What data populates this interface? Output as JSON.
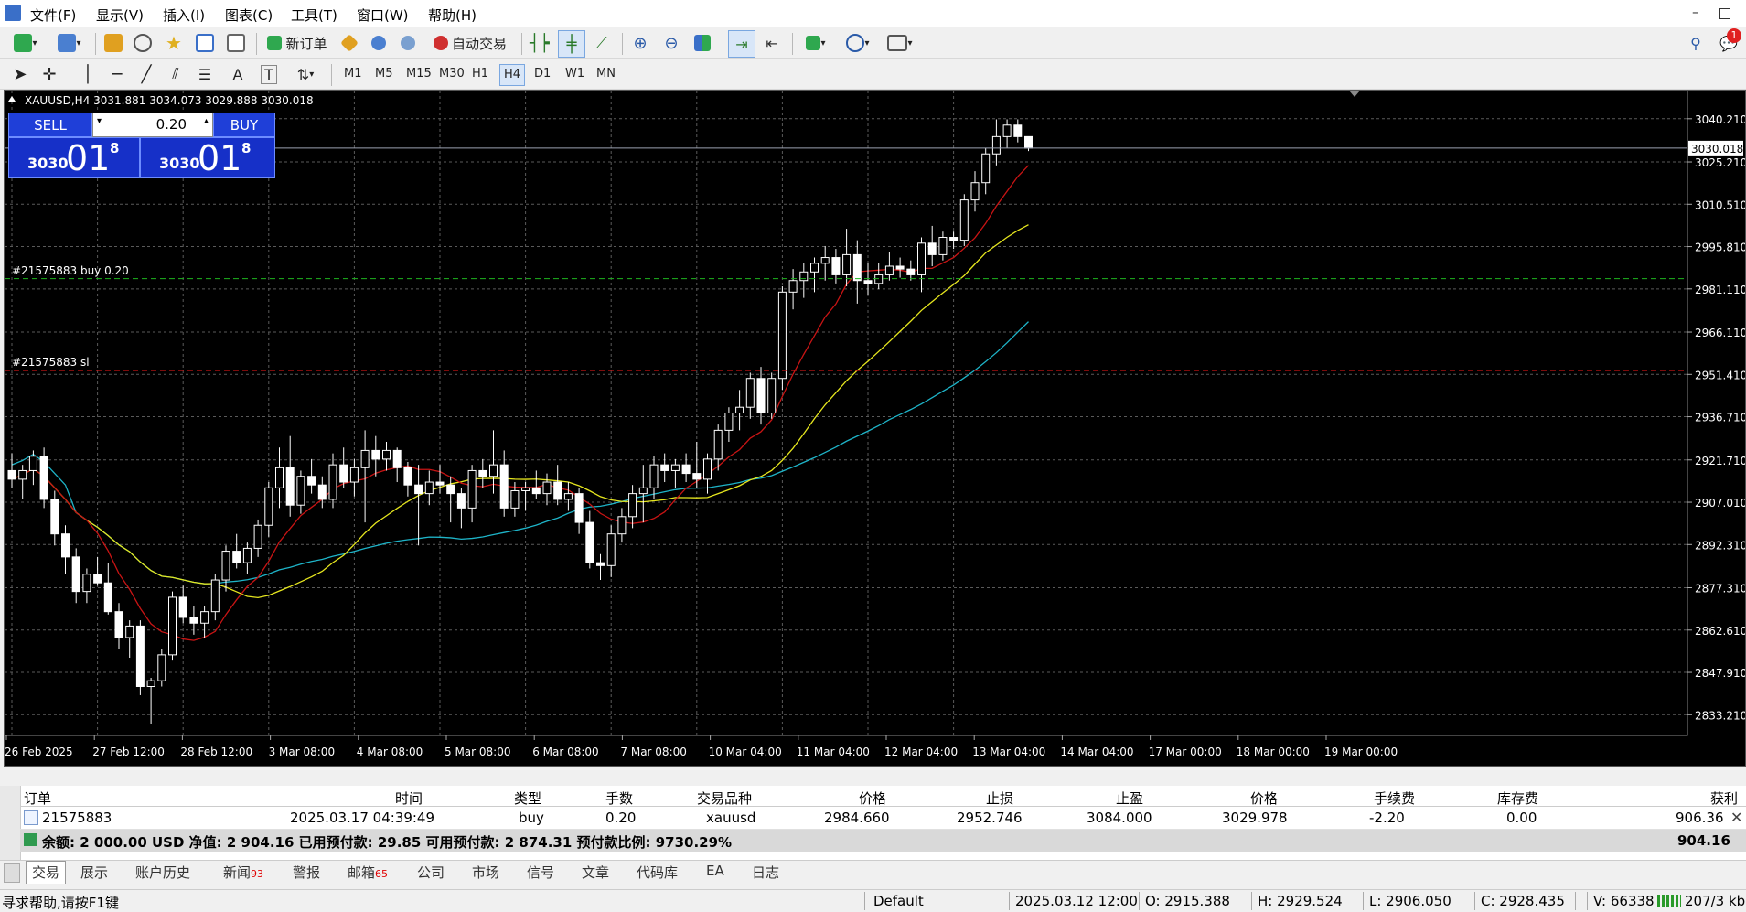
{
  "menu": [
    "文件(F)",
    "显示(V)",
    "插入(I)",
    "图表(C)",
    "工具(T)",
    "窗口(W)",
    "帮助(H)"
  ],
  "toolbar": {
    "new_order": "新订单",
    "auto_trading": "自动交易",
    "timeframes": [
      "M1",
      "M5",
      "M15",
      "M30",
      "H1",
      "H4",
      "D1",
      "W1",
      "MN"
    ],
    "active_timeframe": "H4",
    "notification_count": "1",
    "text_tool": "A",
    "label_tool": "T"
  },
  "chart": {
    "ohlc_line": "XAUUSD,H4  3031.881 3034.073 3029.888 3030.018",
    "current_price_label": "3030.018",
    "order_label_buy": "#21575883 buy 0.20",
    "order_label_sl": "#21575883 sl",
    "oneclick": {
      "sell": "SELL",
      "buy": "BUY",
      "volume": "0.20",
      "sell_price": {
        "big_prefix": "3030",
        "digits": "01",
        "sup": "8"
      },
      "buy_price": {
        "big_prefix": "3030",
        "digits": "01",
        "sup": "8"
      }
    },
    "colors": {
      "bull": "#ffffff",
      "bear": "#ffffff",
      "ma_red": "#c81414",
      "ma_yellow": "#e6e61e",
      "ma_cyan": "#1eb4c8",
      "buy_line": "#1eb41e",
      "sl_line": "#c81414",
      "grid": "#5a5a5a"
    }
  },
  "chart_data": {
    "type": "candlestick",
    "symbol": "XAUUSD",
    "timeframe": "H4",
    "ylim": [
      2826,
      3050
    ],
    "y_ticks": [
      "3040.210",
      "3025.210",
      "3010.510",
      "2995.810",
      "2981.110",
      "2966.110",
      "2951.410",
      "2936.710",
      "2921.710",
      "2907.010",
      "2892.310",
      "2877.310",
      "2862.610",
      "2847.910",
      "2833.210"
    ],
    "x_ticks": [
      "26 Feb 2025",
      "27 Feb 12:00",
      "28 Feb 12:00",
      "3 Mar 08:00",
      "4 Mar 08:00",
      "5 Mar 08:00",
      "6 Mar 08:00",
      "7 Mar 08:00",
      "10 Mar 04:00",
      "11 Mar 04:00",
      "12 Mar 04:00",
      "13 Mar 04:00",
      "14 Mar 04:00",
      "17 Mar 00:00",
      "18 Mar 00:00",
      "19 Mar 00:00"
    ],
    "current_price": 3030.018,
    "buy_level": 2984.66,
    "sl_level": 2952.746,
    "candles": [
      [
        2918,
        2924,
        2912,
        2915
      ],
      [
        2915,
        2920,
        2908,
        2918
      ],
      [
        2918,
        2925,
        2913,
        2923
      ],
      [
        2923,
        2926,
        2905,
        2908
      ],
      [
        2908,
        2911,
        2892,
        2896
      ],
      [
        2896,
        2899,
        2882,
        2888
      ],
      [
        2888,
        2891,
        2872,
        2876
      ],
      [
        2876,
        2884,
        2872,
        2882
      ],
      [
        2882,
        2888,
        2878,
        2879
      ],
      [
        2879,
        2886,
        2868,
        2869
      ],
      [
        2869,
        2872,
        2856,
        2860
      ],
      [
        2860,
        2866,
        2853,
        2864
      ],
      [
        2864,
        2866,
        2840,
        2843
      ],
      [
        2843,
        2846,
        2830,
        2845
      ],
      [
        2845,
        2856,
        2843,
        2854
      ],
      [
        2854,
        2876,
        2852,
        2874
      ],
      [
        2874,
        2878,
        2865,
        2867
      ],
      [
        2867,
        2871,
        2861,
        2865
      ],
      [
        2865,
        2871,
        2860,
        2869
      ],
      [
        2869,
        2882,
        2866,
        2880
      ],
      [
        2880,
        2892,
        2876,
        2890
      ],
      [
        2890,
        2896,
        2884,
        2886
      ],
      [
        2886,
        2893,
        2882,
        2891
      ],
      [
        2891,
        2901,
        2888,
        2899
      ],
      [
        2899,
        2914,
        2895,
        2912
      ],
      [
        2912,
        2926,
        2905,
        2919
      ],
      [
        2919,
        2930,
        2902,
        2906
      ],
      [
        2906,
        2918,
        2903,
        2916
      ],
      [
        2916,
        2922,
        2910,
        2913
      ],
      [
        2913,
        2916,
        2905,
        2908
      ],
      [
        2908,
        2924,
        2905,
        2920
      ],
      [
        2920,
        2926,
        2912,
        2914
      ],
      [
        2914,
        2922,
        2909,
        2919
      ],
      [
        2919,
        2932,
        2900,
        2925
      ],
      [
        2925,
        2930,
        2916,
        2922
      ],
      [
        2922,
        2928,
        2918,
        2925
      ],
      [
        2925,
        2926,
        2914,
        2919
      ],
      [
        2919,
        2921,
        2909,
        2913
      ],
      [
        2913,
        2920,
        2892,
        2910
      ],
      [
        2910,
        2918,
        2906,
        2914
      ],
      [
        2914,
        2920,
        2910,
        2913
      ],
      [
        2913,
        2916,
        2900,
        2910
      ],
      [
        2910,
        2912,
        2898,
        2905
      ],
      [
        2905,
        2920,
        2900,
        2918
      ],
      [
        2918,
        2922,
        2912,
        2916
      ],
      [
        2916,
        2932,
        2910,
        2920
      ],
      [
        2920,
        2925,
        2902,
        2905
      ],
      [
        2905,
        2914,
        2902,
        2911
      ],
      [
        2911,
        2914,
        2904,
        2912
      ],
      [
        2912,
        2918,
        2908,
        2910
      ],
      [
        2910,
        2917,
        2906,
        2914
      ],
      [
        2914,
        2920,
        2906,
        2908
      ],
      [
        2908,
        2914,
        2904,
        2910
      ],
      [
        2910,
        2912,
        2896,
        2900
      ],
      [
        2900,
        2904,
        2884,
        2886
      ],
      [
        2886,
        2889,
        2880,
        2885
      ],
      [
        2885,
        2899,
        2881,
        2896
      ],
      [
        2896,
        2905,
        2893,
        2902
      ],
      [
        2902,
        2913,
        2898,
        2910
      ],
      [
        2910,
        2920,
        2900,
        2912
      ],
      [
        2912,
        2923,
        2908,
        2920
      ],
      [
        2920,
        2924,
        2914,
        2918
      ],
      [
        2918,
        2922,
        2912,
        2920
      ],
      [
        2920,
        2924,
        2914,
        2917
      ],
      [
        2917,
        2928,
        2912,
        2915
      ],
      [
        2915,
        2924,
        2910,
        2922
      ],
      [
        2922,
        2934,
        2918,
        2932
      ],
      [
        2932,
        2940,
        2928,
        2938
      ],
      [
        2938,
        2946,
        2932,
        2940
      ],
      [
        2940,
        2952,
        2936,
        2950
      ],
      [
        2950,
        2954,
        2934,
        2938
      ],
      [
        2938,
        2952,
        2936,
        2950
      ],
      [
        2950,
        2982,
        2946,
        2980
      ],
      [
        2980,
        2988,
        2974,
        2984
      ],
      [
        2984,
        2990,
        2978,
        2987
      ],
      [
        2987,
        2992,
        2980,
        2990
      ],
      [
        2990,
        2996,
        2984,
        2992
      ],
      [
        2992,
        2995,
        2983,
        2986
      ],
      [
        2986,
        3002,
        2982,
        2993
      ],
      [
        2993,
        2998,
        2976,
        2984
      ],
      [
        2984,
        2990,
        2979,
        2983
      ],
      [
        2983,
        2990,
        2981,
        2986
      ],
      [
        2986,
        2994,
        2984,
        2989
      ],
      [
        2989,
        2992,
        2985,
        2988
      ],
      [
        2988,
        2991,
        2984,
        2986
      ],
      [
        2986,
        2999,
        2980,
        2997
      ],
      [
        2997,
        3003,
        2989,
        2993
      ],
      [
        2993,
        3001,
        2991,
        2999
      ],
      [
        2999,
        3001,
        2995,
        2998
      ],
      [
        2998,
        3014,
        2996,
        3012
      ],
      [
        3012,
        3022,
        3008,
        3018
      ],
      [
        3018,
        3030,
        3014,
        3028
      ],
      [
        3028,
        3040,
        3024,
        3034
      ],
      [
        3034,
        3040,
        3030,
        3038
      ],
      [
        3038,
        3040,
        3032,
        3034
      ],
      [
        3034,
        3034,
        3029,
        3030
      ]
    ]
  },
  "terminal": {
    "headers": [
      "订单",
      "时间",
      "类型",
      "手数",
      "交易品种",
      "价格",
      "止损",
      "止盈",
      "价格",
      "手续费",
      "库存费",
      "获利"
    ],
    "rows": [
      [
        "21575883",
        "2025.03.17 04:39:49",
        "buy",
        "0.20",
        "xauusd",
        "2984.660",
        "2952.746",
        "3084.000",
        "3029.978",
        "-2.20",
        "0.00",
        "906.36"
      ]
    ],
    "summary": "余额: 2 000.00 USD  净值: 2 904.16  已用预付款: 29.85  可用预付款: 2 874.31  预付款比例: 9730.29%",
    "summary_total": "904.16"
  },
  "tabs": [
    {
      "label": "交易",
      "badge": ""
    },
    {
      "label": "展示",
      "badge": ""
    },
    {
      "label": "账户历史",
      "badge": ""
    },
    {
      "label": "新闻",
      "badge": "93"
    },
    {
      "label": "警报",
      "badge": ""
    },
    {
      "label": "邮箱",
      "badge": "65"
    },
    {
      "label": "公司",
      "badge": ""
    },
    {
      "label": "市场",
      "badge": ""
    },
    {
      "label": "信号",
      "badge": ""
    },
    {
      "label": "文章",
      "badge": ""
    },
    {
      "label": "代码库",
      "badge": ""
    },
    {
      "label": "EA",
      "badge": ""
    },
    {
      "label": "日志",
      "badge": ""
    }
  ],
  "status": {
    "help": "寻求帮助,请按F1键",
    "profile": "Default",
    "datetime": "2025.03.12 12:00",
    "open": "O: 2915.388",
    "high": "H: 2929.524",
    "low": "L: 2906.050",
    "close": "C: 2928.435",
    "volume": "V: 66338",
    "traffic": "207/3 kb"
  },
  "icons": [
    "new-chart-icon",
    "profiles-icon",
    "market-watch-icon",
    "navigator-icon",
    "favorites-icon",
    "data-window-icon",
    "strategy-tester-icon",
    "new-order-icon",
    "metaeditor-icon",
    "signals-icon",
    "auto-trading-icon",
    "bar-chart-icon",
    "candlestick-icon",
    "line-chart-icon",
    "zoom-in-icon",
    "zoom-out-icon",
    "tile-icon",
    "autoscroll-icon",
    "chart-shift-icon",
    "indicators-icon",
    "periods-icon",
    "templates-icon",
    "search-icon",
    "notification-icon"
  ]
}
